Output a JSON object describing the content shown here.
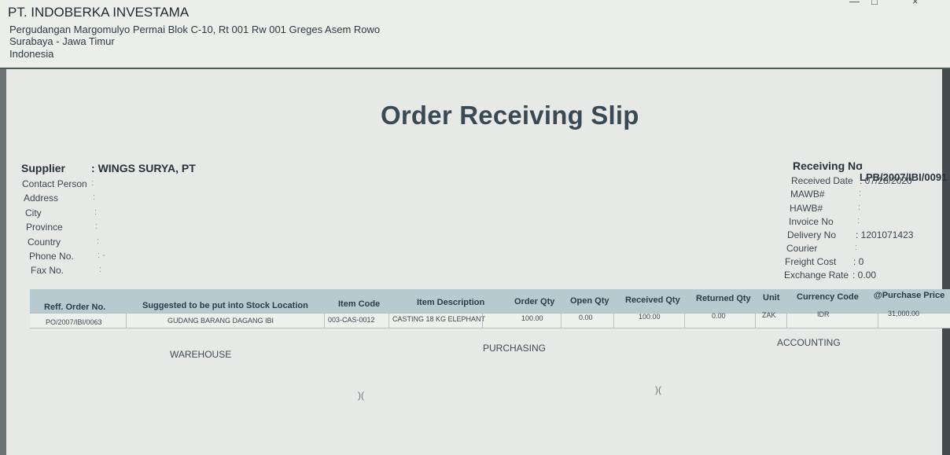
{
  "company": {
    "name": "PT. INDOBERKA INVESTAMA",
    "address_line1": "Pergudangan Margomulyo Permai Blok C-10, Rt 001 Rw 001 Greges Asem Rowo",
    "address_line2": "Surabaya - Jawa Timur",
    "address_line3": "Indonesia"
  },
  "window_controls": {
    "minimize_icon": "minimize-icon",
    "restore_icon": "restore-icon",
    "close_icon": "close-icon"
  },
  "title": "Order Receiving Slip",
  "supplier": {
    "label": "Supplier",
    "value": "WINGS SURYA, PT",
    "fields": [
      {
        "label": "Contact Person",
        "value": ""
      },
      {
        "label": "Address",
        "value": ""
      },
      {
        "label": "City",
        "value": ""
      },
      {
        "label": "Province",
        "value": ""
      },
      {
        "label": "Country",
        "value": ""
      },
      {
        "label": "Phone No.",
        "value": "-"
      },
      {
        "label": "Fax No.",
        "value": ""
      }
    ]
  },
  "receiving": {
    "label": "Receiving No",
    "value": "LPB/2007/IBI/0091",
    "fields": [
      {
        "label": "Received Date",
        "value": "07/28/2020"
      },
      {
        "label": "MAWB#",
        "value": ""
      },
      {
        "label": "HAWB#",
        "value": ""
      },
      {
        "label": "Invoice No",
        "value": ""
      },
      {
        "label": "Delivery No",
        "value": "1201071423"
      },
      {
        "label": "Courier",
        "value": ""
      },
      {
        "label": "Freight Cost",
        "value": "0"
      },
      {
        "label": "Exchange Rate",
        "value": "0.00"
      }
    ]
  },
  "table": {
    "headers": [
      "Reff. Order No.",
      "Suggested to be put into Stock Location",
      "Item Code",
      "Item Description",
      "Order Qty",
      "Open Qty",
      "Received Qty",
      "Returned Qty",
      "Unit",
      "Currency Code",
      "@Purchase Price"
    ],
    "rows": [
      [
        "PO/2007/IBI/0063",
        "GUDANG BARANG DAGANG IBI",
        "003-CAS-0012",
        "CASTING 18 KG ELEPHANT",
        "100.00",
        "0.00",
        "100.00",
        "0.00",
        "ZAK",
        "IDR",
        "31,000.00"
      ]
    ]
  },
  "signatures": {
    "warehouse": "WAREHOUSE",
    "purchasing": "PURCHASING",
    "accounting": "ACCOUNTING",
    "mark1": ")(",
    "mark2": ")("
  }
}
